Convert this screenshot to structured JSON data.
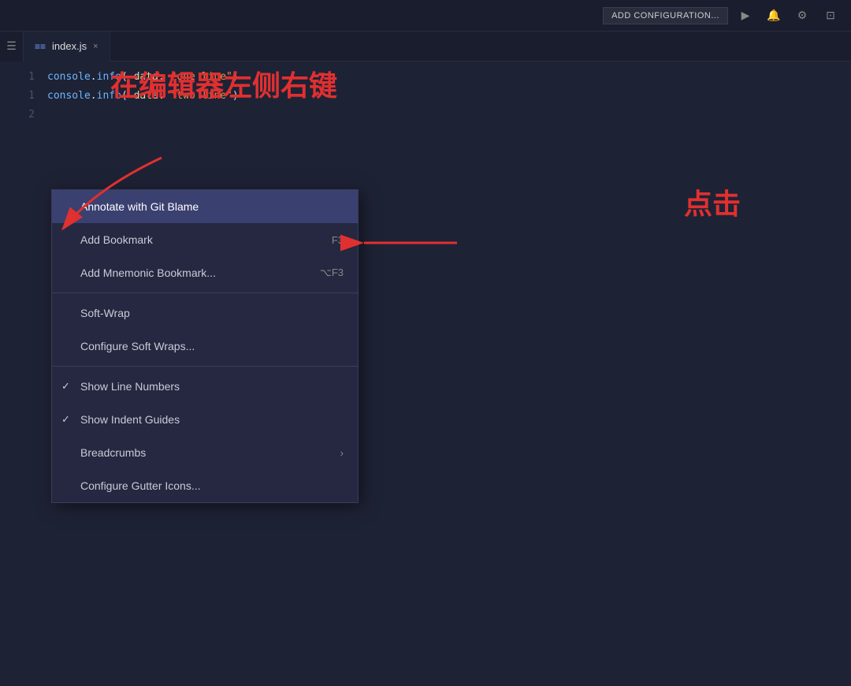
{
  "topbar": {
    "add_config_label": "ADD CONFIGURATION...",
    "icons": [
      "▶",
      "🔔",
      "⚙",
      "⊡"
    ]
  },
  "tab": {
    "icon": "≡",
    "name": "index.js",
    "close": "×"
  },
  "editor": {
    "lines": [
      {
        "number": "1",
        "code": "console.info( data: \"one line\")"
      },
      {
        "number": "1",
        "code": "console.info( data: \"two line\")"
      },
      {
        "number": "2",
        "code": ""
      }
    ]
  },
  "annotation1": {
    "text": "在编辑器左侧右键"
  },
  "annotation2": {
    "text": "点击"
  },
  "context_menu": {
    "items": [
      {
        "id": "annotate-git-blame",
        "label": "Annotate with Git Blame",
        "shortcut": "",
        "active": true,
        "checked": false,
        "has_arrow": false
      },
      {
        "id": "add-bookmark",
        "label": "Add Bookmark",
        "shortcut": "F3",
        "active": false,
        "checked": false,
        "has_arrow": false
      },
      {
        "id": "add-mnemonic-bookmark",
        "label": "Add Mnemonic Bookmark...",
        "shortcut": "⌥F3",
        "active": false,
        "checked": false,
        "has_arrow": false
      },
      {
        "id": "divider1",
        "type": "divider"
      },
      {
        "id": "soft-wrap",
        "label": "Soft-Wrap",
        "shortcut": "",
        "active": false,
        "checked": false,
        "has_arrow": false
      },
      {
        "id": "configure-soft-wraps",
        "label": "Configure Soft Wraps...",
        "shortcut": "",
        "active": false,
        "checked": false,
        "has_arrow": false
      },
      {
        "id": "divider2",
        "type": "divider"
      },
      {
        "id": "show-line-numbers",
        "label": "Show Line Numbers",
        "shortcut": "",
        "active": false,
        "checked": true,
        "has_arrow": false
      },
      {
        "id": "show-indent-guides",
        "label": "Show Indent Guides",
        "shortcut": "",
        "active": false,
        "checked": true,
        "has_arrow": false
      },
      {
        "id": "breadcrumbs",
        "label": "Breadcrumbs",
        "shortcut": "",
        "active": false,
        "checked": false,
        "has_arrow": true
      },
      {
        "id": "configure-gutter-icons",
        "label": "Configure Gutter Icons...",
        "shortcut": "",
        "active": false,
        "checked": false,
        "has_arrow": false
      }
    ]
  }
}
